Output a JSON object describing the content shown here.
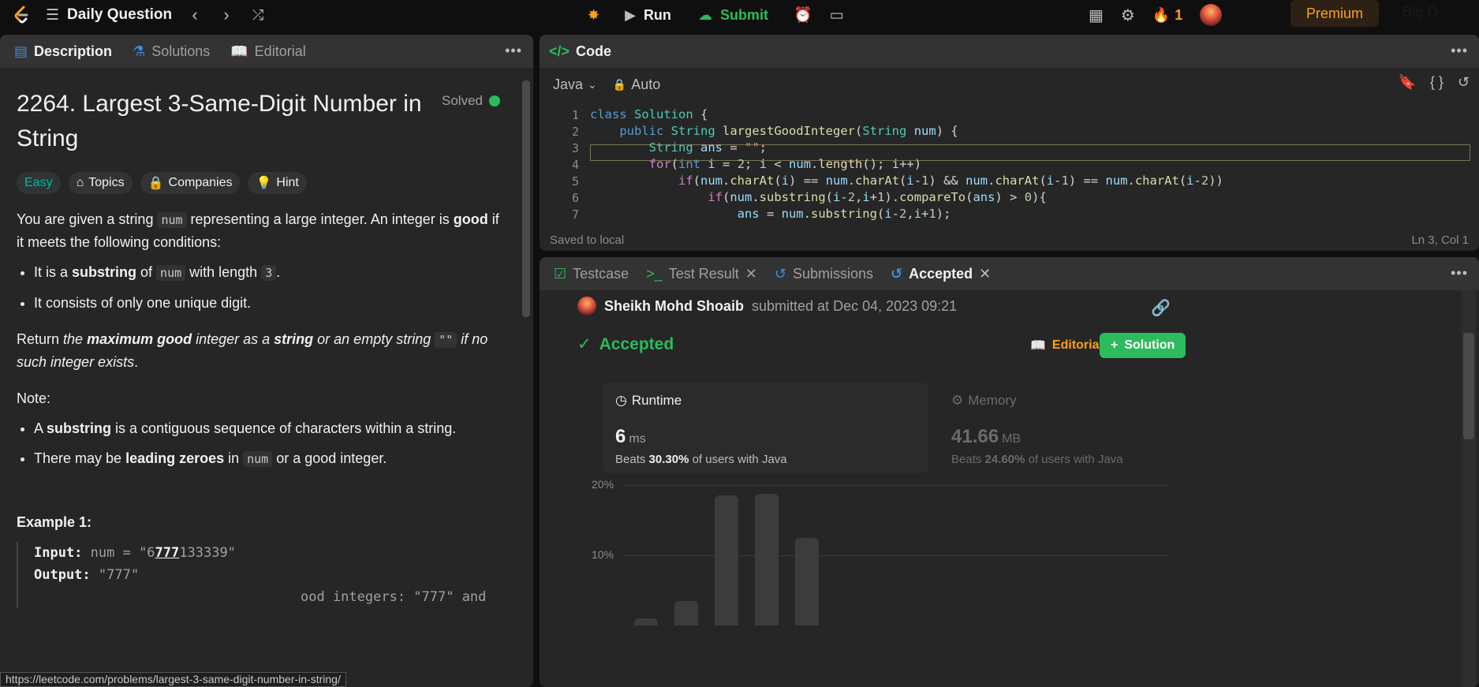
{
  "topbar": {
    "daily_label": "Daily Question",
    "run_label": "Run",
    "submit_label": "Submit",
    "streak_count": "1",
    "premium_label": "Premium",
    "bigo_label": "Big O"
  },
  "description": {
    "tabs": [
      {
        "label": "Description"
      },
      {
        "label": "Solutions"
      },
      {
        "label": "Editorial"
      }
    ],
    "title": "2264. Largest 3-Same-Digit Number in String",
    "solved_label": "Solved",
    "chips": {
      "difficulty": "Easy",
      "topics": "Topics",
      "companies": "Companies",
      "hint": "Hint"
    },
    "p1_a": "You are given a string ",
    "p1_code": "num",
    "p1_b": " representing a large integer. An integer is ",
    "p1_bold": "good",
    "p1_c": " if it meets the following conditions:",
    "bullet1_a": "It is a ",
    "bullet1_bold": "substring",
    "bullet1_b": " of ",
    "bullet1_code": "num",
    "bullet1_c": " with length ",
    "bullet1_code2": "3",
    "bullet1_d": ".",
    "bullet2": "It consists of only one unique digit.",
    "p2_a": "Return ",
    "p2_i1": "the ",
    "p2_bi1": "maximum good",
    "p2_i2": " integer as a ",
    "p2_bi2": "string",
    "p2_i3": " or an empty string ",
    "p2_code": "\"\"",
    "p2_i4": " if no such integer exists",
    "p2_end": ".",
    "note_label": "Note:",
    "note1_a": "A ",
    "note1_bold": "substring",
    "note1_b": " is a contiguous sequence of characters within a string.",
    "note2_a": "There may be ",
    "note2_bold": "leading zeroes",
    "note2_b": " in ",
    "note2_code": "num",
    "note2_c": " or a good integer.",
    "example_heading": "Example 1:",
    "example_input_label": "Input:",
    "example_input_a": " num = \"6",
    "example_input_u": "777",
    "example_input_b": "133339\"",
    "example_output_label": "Output:",
    "example_output": " \"777\"",
    "example_explain": "ood integers: \"777\" and",
    "status_url": "https://leetcode.com/problems/largest-3-same-digit-number-in-string/"
  },
  "code": {
    "tab_label": "Code",
    "language": "Java",
    "auto_label": "Auto",
    "saved_label": "Saved to local",
    "cursor_pos": "Ln 3, Col 1",
    "line_numbers": [
      "1",
      "2",
      "3",
      "4",
      "5",
      "6",
      "7"
    ]
  },
  "result": {
    "tabs": [
      {
        "label": "Testcase"
      },
      {
        "label": "Test Result"
      },
      {
        "label": "Submissions"
      },
      {
        "label": "Accepted"
      }
    ],
    "user_name": "Sheikh Mohd Shoaib",
    "submitted_text": "submitted at Dec 04, 2023 09:21",
    "status": "Accepted",
    "editorial_btn": "Editorial",
    "solution_btn": "Solution",
    "runtime": {
      "title": "Runtime",
      "value": "6",
      "unit": "ms",
      "beats_prefix": "Beats ",
      "beats_pct": "30.30%",
      "beats_suffix": " of users with Java"
    },
    "memory": {
      "title": "Memory",
      "value": "41.66",
      "unit": "MB",
      "beats_prefix": "Beats ",
      "beats_pct": "24.60%",
      "beats_suffix": " of users with Java"
    }
  },
  "chart_data": {
    "type": "bar",
    "yticks": [
      "20%",
      "10%"
    ],
    "values": [
      1.0,
      3.5,
      18.5,
      18.8,
      12.5
    ],
    "ylim": [
      0,
      20
    ]
  }
}
